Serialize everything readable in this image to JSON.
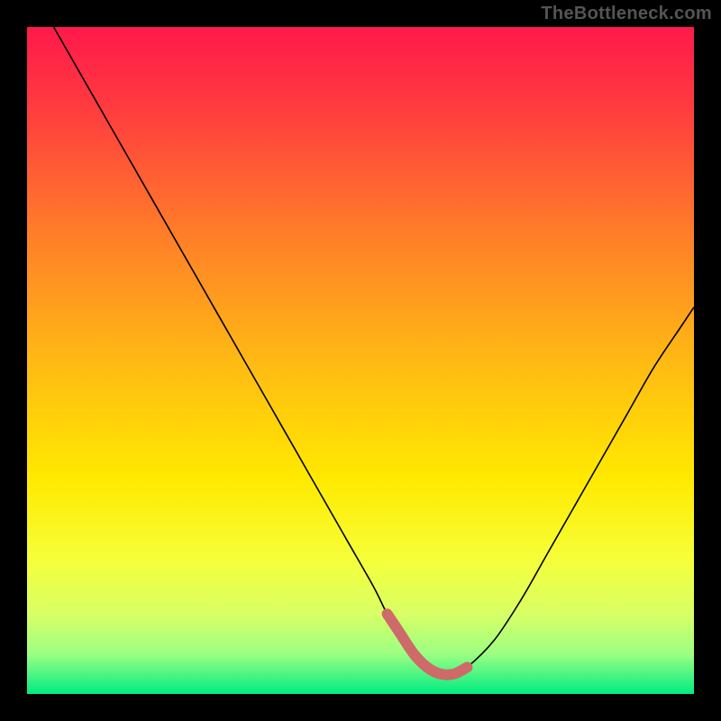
{
  "watermark": "TheBottleneck.com",
  "chart_data": {
    "type": "line",
    "title": "",
    "xlabel": "",
    "ylabel": "",
    "xlim": [
      0,
      100
    ],
    "ylim": [
      0,
      100
    ],
    "grid": false,
    "legend": false,
    "series": [
      {
        "name": "curve",
        "x": [
          4,
          8,
          12,
          16,
          20,
          24,
          28,
          32,
          36,
          40,
          44,
          48,
          52,
          54,
          56,
          58,
          60,
          62,
          64,
          66,
          70,
          74,
          78,
          82,
          86,
          90,
          94,
          98,
          100
        ],
        "y": [
          100,
          93,
          86,
          79,
          72,
          65,
          58,
          51,
          44,
          37,
          30,
          23,
          16,
          12,
          9,
          6,
          4,
          3,
          3,
          4,
          8,
          14,
          21,
          28,
          35,
          42,
          49,
          55,
          58
        ]
      }
    ],
    "annotations": [
      {
        "name": "basin-highlight",
        "color": "#cf6a6a",
        "x": [
          54,
          56,
          58,
          60,
          62,
          64,
          66
        ],
        "y": [
          12,
          9,
          6,
          4,
          3,
          3,
          4
        ]
      }
    ],
    "background_gradient": {
      "top_rgb": [
        255,
        25,
        75
      ],
      "mid_rgb": [
        255,
        235,
        0
      ],
      "bottom_rgb": [
        0,
        235,
        130
      ]
    }
  }
}
